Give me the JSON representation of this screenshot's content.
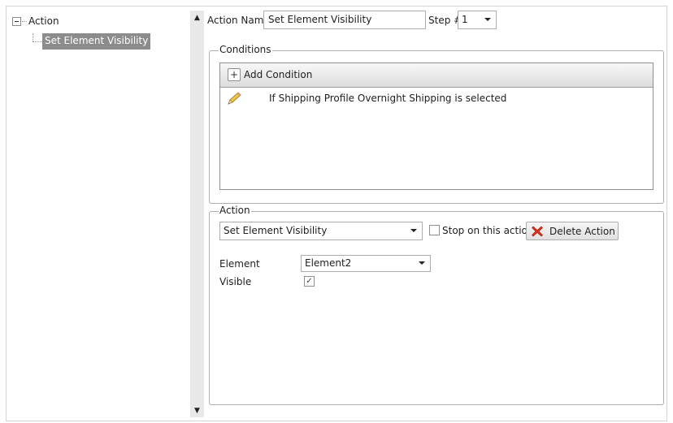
{
  "tree": {
    "root_label": "Action",
    "child_label": "Set Element Visibility"
  },
  "header": {
    "action_name_label": "Action Name",
    "action_name_value": "Set Element Visibility",
    "step_label": "Step #",
    "step_value": "1"
  },
  "conditions": {
    "group_title": "Conditions",
    "add_button_label": "Add Condition",
    "items": [
      {
        "text": "If Shipping Profile Overnight Shipping is selected",
        "icon": "pencil-icon"
      }
    ]
  },
  "action": {
    "group_title": "Action",
    "type_value": "Set Element Visibility",
    "stop_label": "Stop on this action",
    "stop_checked": false,
    "delete_label": "Delete Action",
    "element_label": "Element",
    "element_value": "Element2",
    "visible_label": "Visible",
    "visible_checked": true
  },
  "colors": {
    "selection_bg": "#8c8c8c",
    "border": "#aeaeae",
    "delete_icon": "#e0311a"
  }
}
